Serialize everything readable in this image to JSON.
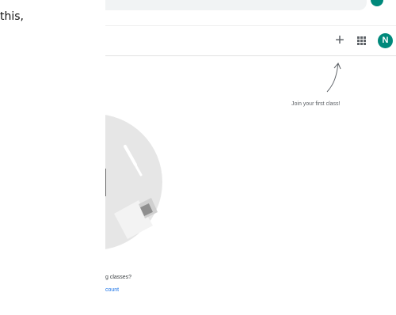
{
  "document": {
    "fragment_text": "this,"
  },
  "header": {
    "plus_icon": "+",
    "apps_icon": "apps-grid-icon",
    "avatar_initial": "N"
  },
  "empty_state": {
    "hint_text": "Join your first class!",
    "question_text": "g classes?",
    "link_text": "count"
  },
  "colors": {
    "avatar": "#00897b",
    "link": "#1a73e8"
  }
}
